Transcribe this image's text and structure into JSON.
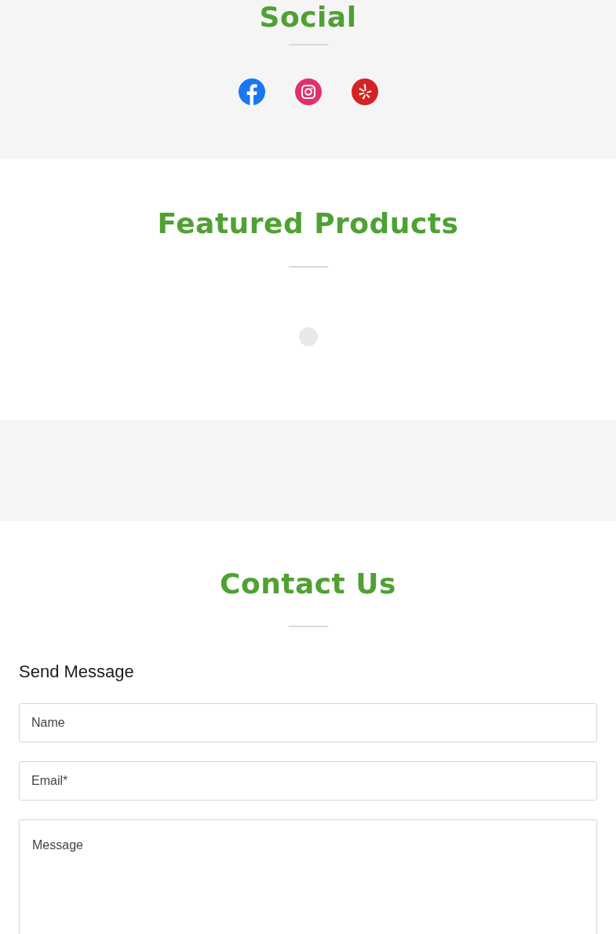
{
  "social": {
    "title": "Social",
    "links": [
      {
        "kind": "facebook"
      },
      {
        "kind": "instagram"
      },
      {
        "kind": "yelp"
      }
    ]
  },
  "featured": {
    "title": "Featured Products"
  },
  "contact": {
    "title": "Contact Us",
    "form_title": "Send Message",
    "fields": [
      {
        "kind": "input",
        "placeholder": "Name"
      },
      {
        "kind": "input",
        "placeholder": "Email*"
      },
      {
        "kind": "textarea",
        "placeholder": "Message"
      }
    ]
  }
}
